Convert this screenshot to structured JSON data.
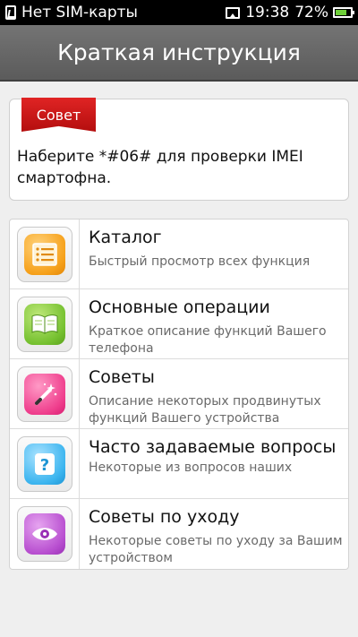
{
  "statusbar": {
    "carrier": "Нет SIM-карты",
    "time": "19:38",
    "battery": "72%",
    "battery_level": 0.72,
    "icons": [
      "sim-card-icon",
      "picture-icon",
      "battery-icon"
    ]
  },
  "header": {
    "title": "Краткая инструкция"
  },
  "tip": {
    "badge": "Совет",
    "text": "Наберите *#06# для проверки IMEI смартофна."
  },
  "menu": {
    "items": [
      {
        "title": "Каталог",
        "desc": "Быстрый просмотр всех функция",
        "icon": "catalog-list-icon",
        "color": "#f6a11b"
      },
      {
        "title": "Основные операции",
        "desc": "Краткое описание функций Вашего телефона",
        "icon": "book-icon",
        "color": "#76c130"
      },
      {
        "title": "Советы",
        "desc": "Описание некоторых продвинутых функций Вашего устройства",
        "icon": "magic-wand-icon",
        "color": "#ef3f8d"
      },
      {
        "title": "Часто задаваемые вопросы",
        "desc": "Некоторые из вопросов наших",
        "icon": "question-icon",
        "color": "#3cb5ef"
      },
      {
        "title": "Советы по уходу",
        "desc": "Некоторые советы по уходу за Вашим устройством",
        "icon": "eye-icon",
        "color": "#b84fd0"
      }
    ]
  }
}
